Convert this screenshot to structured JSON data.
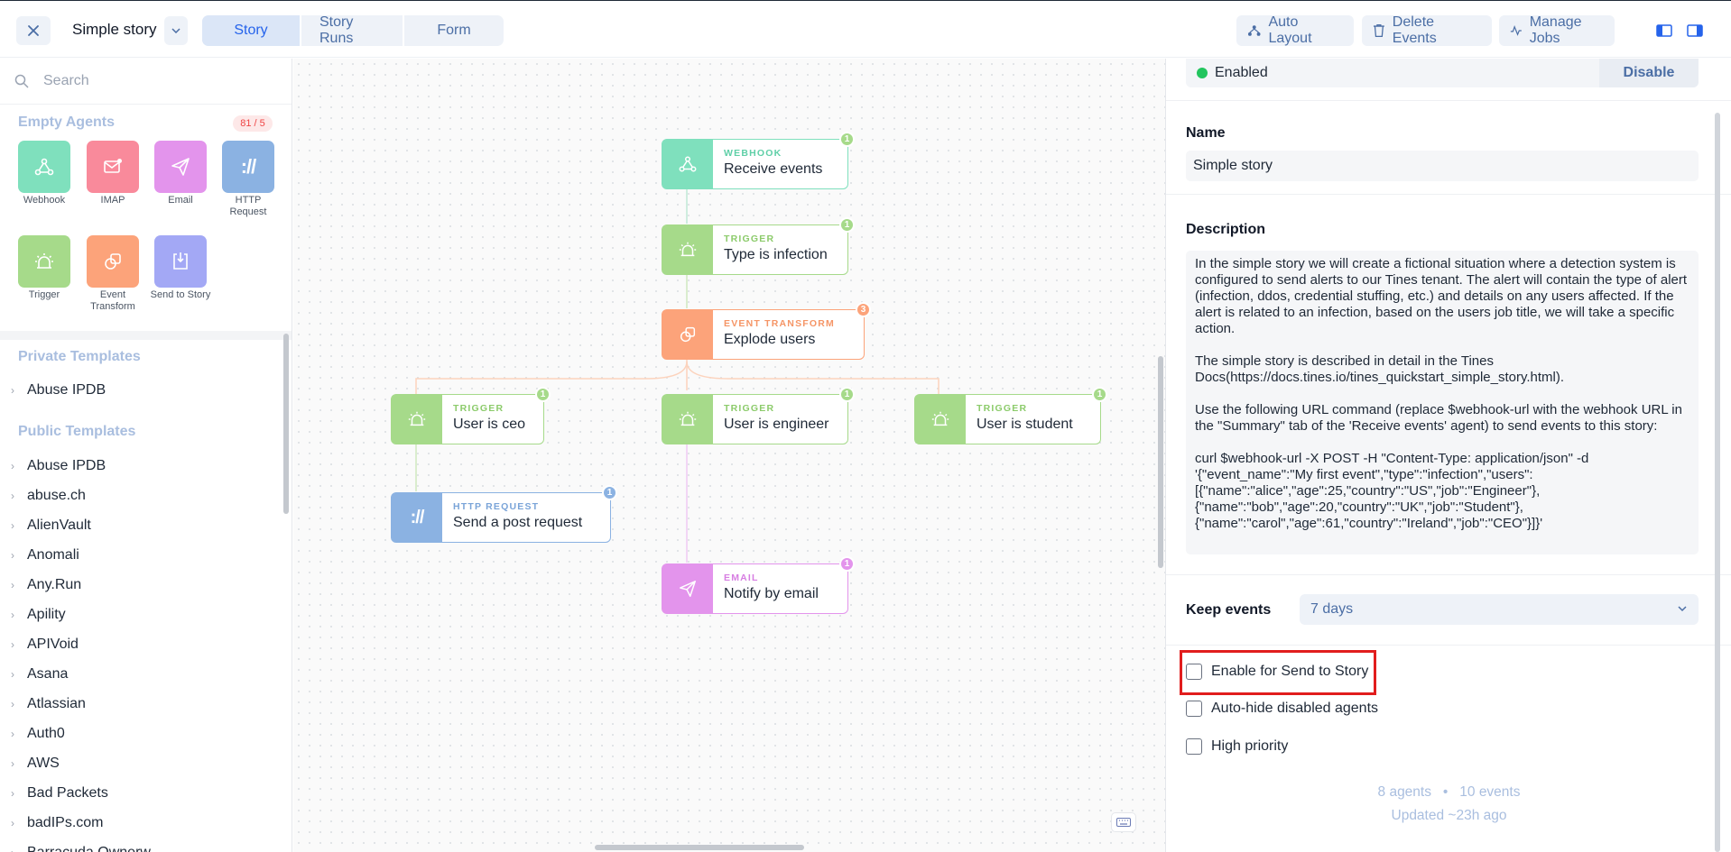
{
  "topbar": {
    "story_name": "Simple story",
    "tabs": [
      {
        "label": "Story",
        "active": true
      },
      {
        "label": "Story Runs",
        "active": false
      },
      {
        "label": "Form",
        "active": false
      }
    ],
    "auto_layout": "Auto Layout",
    "delete_events": "Delete Events",
    "manage_jobs": "Manage Jobs"
  },
  "sidebar": {
    "search_placeholder": "Search",
    "empty_agents_title": "Empty Agents",
    "agent_count": "81 / 5",
    "agents": [
      {
        "label": "Webhook",
        "icon": "webhook-icon",
        "color": "#7fe0bd"
      },
      {
        "label": "IMAP",
        "icon": "mail-icon",
        "color": "#f98a9b"
      },
      {
        "label": "Email",
        "icon": "paper-plane-icon",
        "color": "#e394ec"
      },
      {
        "label": "HTTP Request",
        "icon": "http-icon",
        "color": "#8bb2e2"
      },
      {
        "label": "Trigger",
        "icon": "alarm-icon",
        "color": "#a6da8a"
      },
      {
        "label": "Event Transform",
        "icon": "transform-icon",
        "color": "#fca37a"
      },
      {
        "label": "Send to Story",
        "icon": "send-story-icon",
        "color": "#a3a8f5"
      }
    ],
    "private_title": "Private Templates",
    "private_items": [
      "Abuse IPDB"
    ],
    "public_title": "Public Templates",
    "public_items": [
      "Abuse IPDB",
      "abuse.ch",
      "AlienVault",
      "Anomali",
      "Any.Run",
      "Apility",
      "APIVoid",
      "Asana",
      "Atlassian",
      "Auth0",
      "AWS",
      "Bad Packets",
      "badIPs.com",
      "Barracuda Ownerw"
    ]
  },
  "canvas": {
    "nodes": [
      {
        "type": "WEBHOOK",
        "name": "Receive events",
        "badge": "1",
        "color": "#7fe0bd",
        "text_color": "#5fcfa7",
        "icon": "webhook-icon"
      },
      {
        "type": "TRIGGER",
        "name": "Type is infection",
        "badge": "1",
        "color": "#a6da8a",
        "text_color": "#8ccb6b",
        "icon": "alarm-icon"
      },
      {
        "type": "EVENT TRANSFORM",
        "name": "Explode users",
        "badge": "3",
        "color": "#fca37a",
        "text_color": "#f59566",
        "icon": "transform-icon"
      },
      {
        "type": "TRIGGER",
        "name": "User is ceo",
        "badge": "1",
        "color": "#a6da8a",
        "text_color": "#8ccb6b",
        "icon": "alarm-icon"
      },
      {
        "type": "TRIGGER",
        "name": "User is engineer",
        "badge": "1",
        "color": "#a6da8a",
        "text_color": "#8ccb6b",
        "icon": "alarm-icon"
      },
      {
        "type": "TRIGGER",
        "name": "User is student",
        "badge": "1",
        "color": "#a6da8a",
        "text_color": "#8ccb6b",
        "icon": "alarm-icon"
      },
      {
        "type": "HTTP REQUEST",
        "name": "Send a post request",
        "badge": "1",
        "color": "#8bb2e2",
        "text_color": "#7aa4d8",
        "icon": "http-icon"
      },
      {
        "type": "EMAIL",
        "name": "Notify by email",
        "badge": "1",
        "color": "#e394ec",
        "text_color": "#d77ee2",
        "icon": "paper-plane-icon"
      }
    ]
  },
  "panel": {
    "status": "Enabled",
    "disable_label": "Disable",
    "name_label": "Name",
    "name_value": "Simple story",
    "description_label": "Description",
    "description": "In the simple story we will create a fictional situation where a detection system is configured to send alerts to our Tines tenant. The alert will contain the type of alert (infection, ddos, credential stuffing, etc.) and details on any users affected. If the alert is related to an infection, based on the users job title, we will take a specific action.\n\nThe simple story is described in detail in the Tines Docs(https://docs.tines.io/tines_quickstart_simple_story.html).\n\nUse the following URL command (replace $webhook-url with the webhook URL in the \"Summary\" tab of the 'Receive events' agent) to send events to this story:\n\ncurl $webhook-url -X POST -H \"Content-Type: application/json\" -d '{\"event_name\":\"My first event\",\"type\":\"infection\",\"users\":[{\"name\":\"alice\",\"age\":25,\"country\":\"US\",\"job\":\"Engineer\"},{\"name\":\"bob\",\"age\":20,\"country\":\"UK\",\"job\":\"Student\"},{\"name\":\"carol\",\"age\":61,\"country\":\"Ireland\",\"job\":\"CEO\"}]}'",
    "keep_events_label": "Keep events",
    "keep_events_value": "7 days",
    "checkboxes": [
      {
        "label": "Enable for Send to Story",
        "checked": false
      },
      {
        "label": "Auto-hide disabled agents",
        "checked": false
      },
      {
        "label": "High priority",
        "checked": false
      }
    ],
    "agents_count": "8 agents",
    "events_count": "10 events",
    "updated": "Updated ~23h ago"
  }
}
